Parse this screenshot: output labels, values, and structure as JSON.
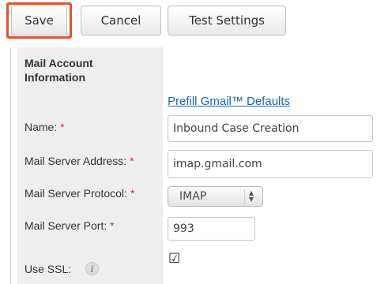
{
  "toolbar": {
    "save_label": "Save",
    "cancel_label": "Cancel",
    "test_label": "Test Settings"
  },
  "form": {
    "section_title": "Mail Account Information",
    "prefill_link": "Prefill Gmail™ Defaults",
    "required_marker": "*",
    "name": {
      "label": "Name:",
      "value": "Inbound Case Creation"
    },
    "server_address": {
      "label": "Mail Server Address:",
      "value": "imap.gmail.com"
    },
    "protocol": {
      "label": "Mail Server Protocol:",
      "value": "IMAP"
    },
    "port": {
      "label": "Mail Server Port:",
      "value": "993"
    },
    "ssl": {
      "label": "Use SSL:",
      "checked": true,
      "info_icon": "info-icon"
    }
  },
  "colors": {
    "highlight": "#e5502a",
    "required": "#d9312b",
    "link": "#1b63c0",
    "label_column_bg": "#eeeeee"
  }
}
